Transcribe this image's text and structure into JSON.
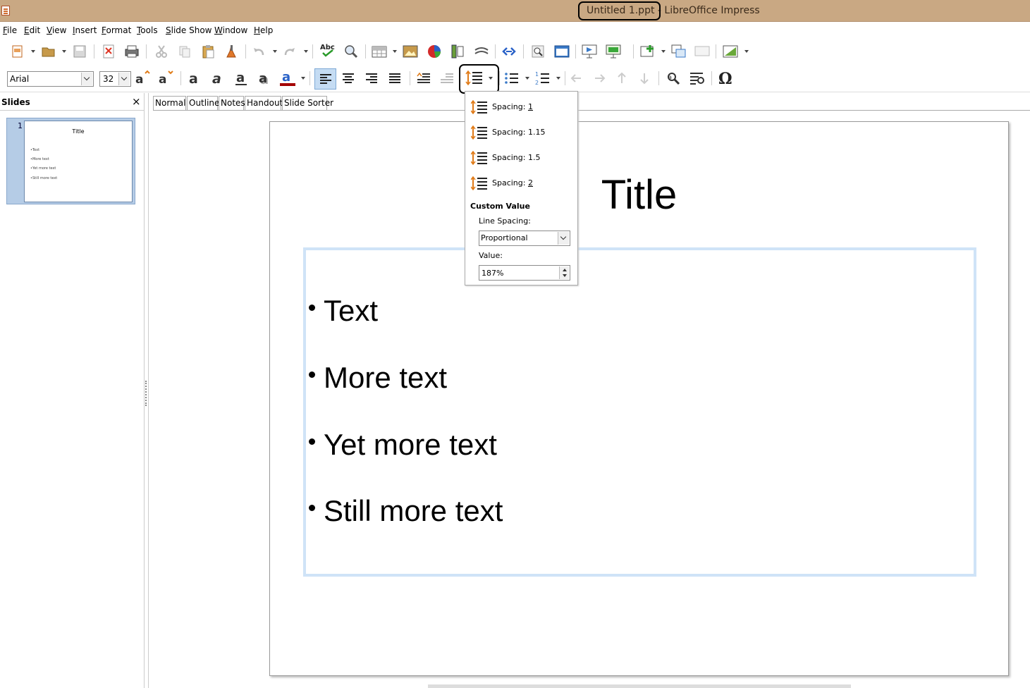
{
  "window": {
    "title": "Untitled 1.ppt - LibreOffice Impress"
  },
  "menu": {
    "items": [
      "File",
      "Edit",
      "View",
      "Insert",
      "Format",
      "Tools",
      "Slide Show",
      "Window",
      "Help"
    ]
  },
  "formatting": {
    "font_name": "Arial",
    "font_size": "32"
  },
  "slides_pane": {
    "title": "Slides",
    "close": "×",
    "thumbnail": {
      "number": "1",
      "title": "Title",
      "bullets": [
        "•Text",
        "•More text",
        "•Yet more text",
        "•Still more text"
      ]
    }
  },
  "tabs": [
    "Normal",
    "Outline",
    "Notes",
    "Handout",
    "Slide Sorter"
  ],
  "slide": {
    "title": "Title",
    "bullets": [
      "Text",
      "More text",
      "Yet more text",
      "Still more text"
    ]
  },
  "spacing_popup": {
    "items": [
      {
        "prefix": "Spacing: ",
        "value": "1"
      },
      {
        "prefix": "Spacing: ",
        "value": "1.15"
      },
      {
        "prefix": "Spacing: ",
        "value": "1.5"
      },
      {
        "prefix": "Spacing: ",
        "value": "2"
      }
    ],
    "custom_value_title": "Custom Value",
    "line_spacing_label": "Line Spacing:",
    "line_spacing_value": "Proportional",
    "value_label": "Value:",
    "value": "187%"
  },
  "colors": {
    "titlebar": "#c9a883",
    "selection": "#b5cce6",
    "content_box_border": "#cfe3f7",
    "accent_orange": "#e07b18"
  }
}
